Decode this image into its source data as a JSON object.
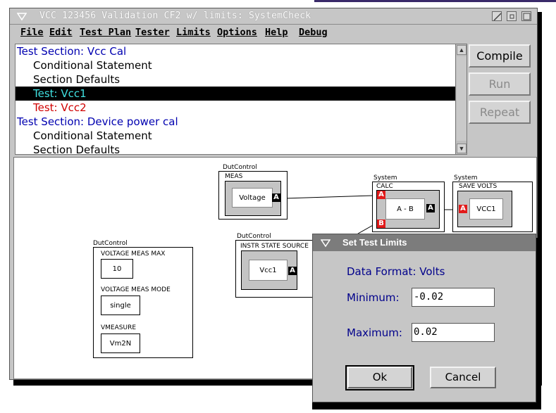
{
  "window": {
    "title": "VCC 123456 Validation CF2 w/ limits: SystemCheck"
  },
  "menu": [
    "File",
    "Edit",
    "Test Plan",
    "Tester",
    "Limits",
    "Options",
    "Help",
    "Debug"
  ],
  "tree": [
    {
      "text": "Test Section: Vcc Cal",
      "indent": false,
      "color": "#0000b0",
      "selected": false
    },
    {
      "text": "Conditional Statement",
      "indent": true,
      "color": "#000000",
      "selected": false
    },
    {
      "text": "Section Defaults",
      "indent": true,
      "color": "#000000",
      "selected": false
    },
    {
      "text": "Test: Vcc1",
      "indent": true,
      "color": "#40e0e0",
      "selected": true
    },
    {
      "text": "Test: Vcc2",
      "indent": true,
      "color": "#d00000",
      "selected": false
    },
    {
      "text": "Test Section: Device power cal",
      "indent": false,
      "color": "#0000b0",
      "selected": false
    },
    {
      "text": "Conditional Statement",
      "indent": true,
      "color": "#000000",
      "selected": false
    },
    {
      "text": "Section Defaults",
      "indent": true,
      "color": "#000000",
      "selected": false
    }
  ],
  "buttons": {
    "compile": "Compile",
    "run": "Run",
    "repeat": "Repeat"
  },
  "canvas": {
    "dut_meas": {
      "group": "DutControl",
      "title": "MEAS",
      "inner": "Voltage",
      "port": "A"
    },
    "calc": {
      "group": "System",
      "title": "CALC",
      "inner": "A - B",
      "port_a": "A",
      "port_b": "B",
      "port_out": "A"
    },
    "save": {
      "group": "System",
      "title": "SAVE VOLTS",
      "inner": "VCC1",
      "port": "A"
    },
    "instr": {
      "group": "DutControl",
      "title": "INSTR STATE SOURCE",
      "inner": "Vcc1",
      "port": "A"
    },
    "volt_panel": {
      "group": "DutControl",
      "max_label": "VOLTAGE MEAS MAX",
      "max_value": "10",
      "mode_label": "VOLTAGE MEAS MODE",
      "mode_value": "single",
      "vmeasure_label": "VMEASURE",
      "vmeasure_value": "Vm2N"
    }
  },
  "dialog": {
    "title": "Set Test Limits",
    "format": "Data Format: Volts",
    "min_label": "Minimum:",
    "min_value": "-0.02",
    "max_label": "Maximum:",
    "max_value": "0.02",
    "ok": "Ok",
    "cancel": "Cancel"
  }
}
